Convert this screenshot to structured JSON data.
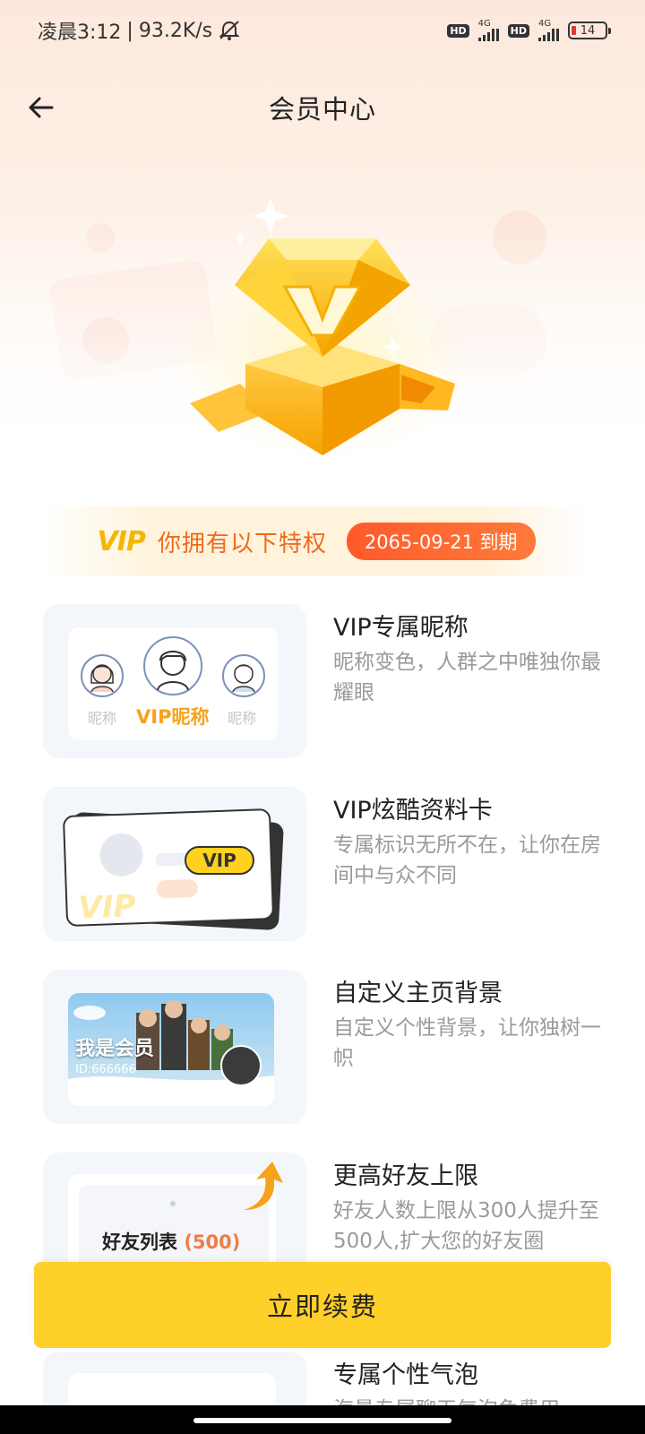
{
  "status_bar": {
    "time": "凌晨3:12",
    "net_speed": "93.2K/s",
    "hd1": "HD",
    "net1": "4G",
    "hd2": "HD",
    "net2": "4G",
    "battery": "14"
  },
  "header": {
    "title": "会员中心"
  },
  "privilege": {
    "logo_text": "VIP",
    "text": "你拥有以下特权",
    "expire": "2065-09-21 到期"
  },
  "benefits": [
    {
      "title": "VIP专属昵称",
      "desc": "昵称变色，人群之中唯独你最耀眼",
      "thumb": {
        "label_left": "昵称",
        "label_center": "VIP昵称",
        "label_right": "昵称"
      }
    },
    {
      "title": "VIP炫酷资料卡",
      "desc": "专属标识无所不在，让你在房间中与众不同",
      "thumb": {
        "badge": "VIP",
        "watermark": "VIP"
      }
    },
    {
      "title": "自定义主页背景",
      "desc": "自定义个性背景，让你独树一帜",
      "thumb": {
        "title": "我是会员",
        "id": "ID:666666"
      }
    },
    {
      "title": "更高好友上限",
      "desc": "好友人数上限从300人提升至500人,扩大您的好友圈",
      "thumb": {
        "list_label": "好友列表",
        "count": "(500)"
      }
    },
    {
      "title": "专属个性气泡",
      "desc": "海量专属聊天气泡免费用"
    }
  ],
  "renew_button": "立即续费",
  "colors": {
    "accent_orange": "#f06a1e",
    "expire_badge": "#ff5a2a",
    "button_yellow": "#ffcf2a",
    "gold": "#f7b500"
  }
}
